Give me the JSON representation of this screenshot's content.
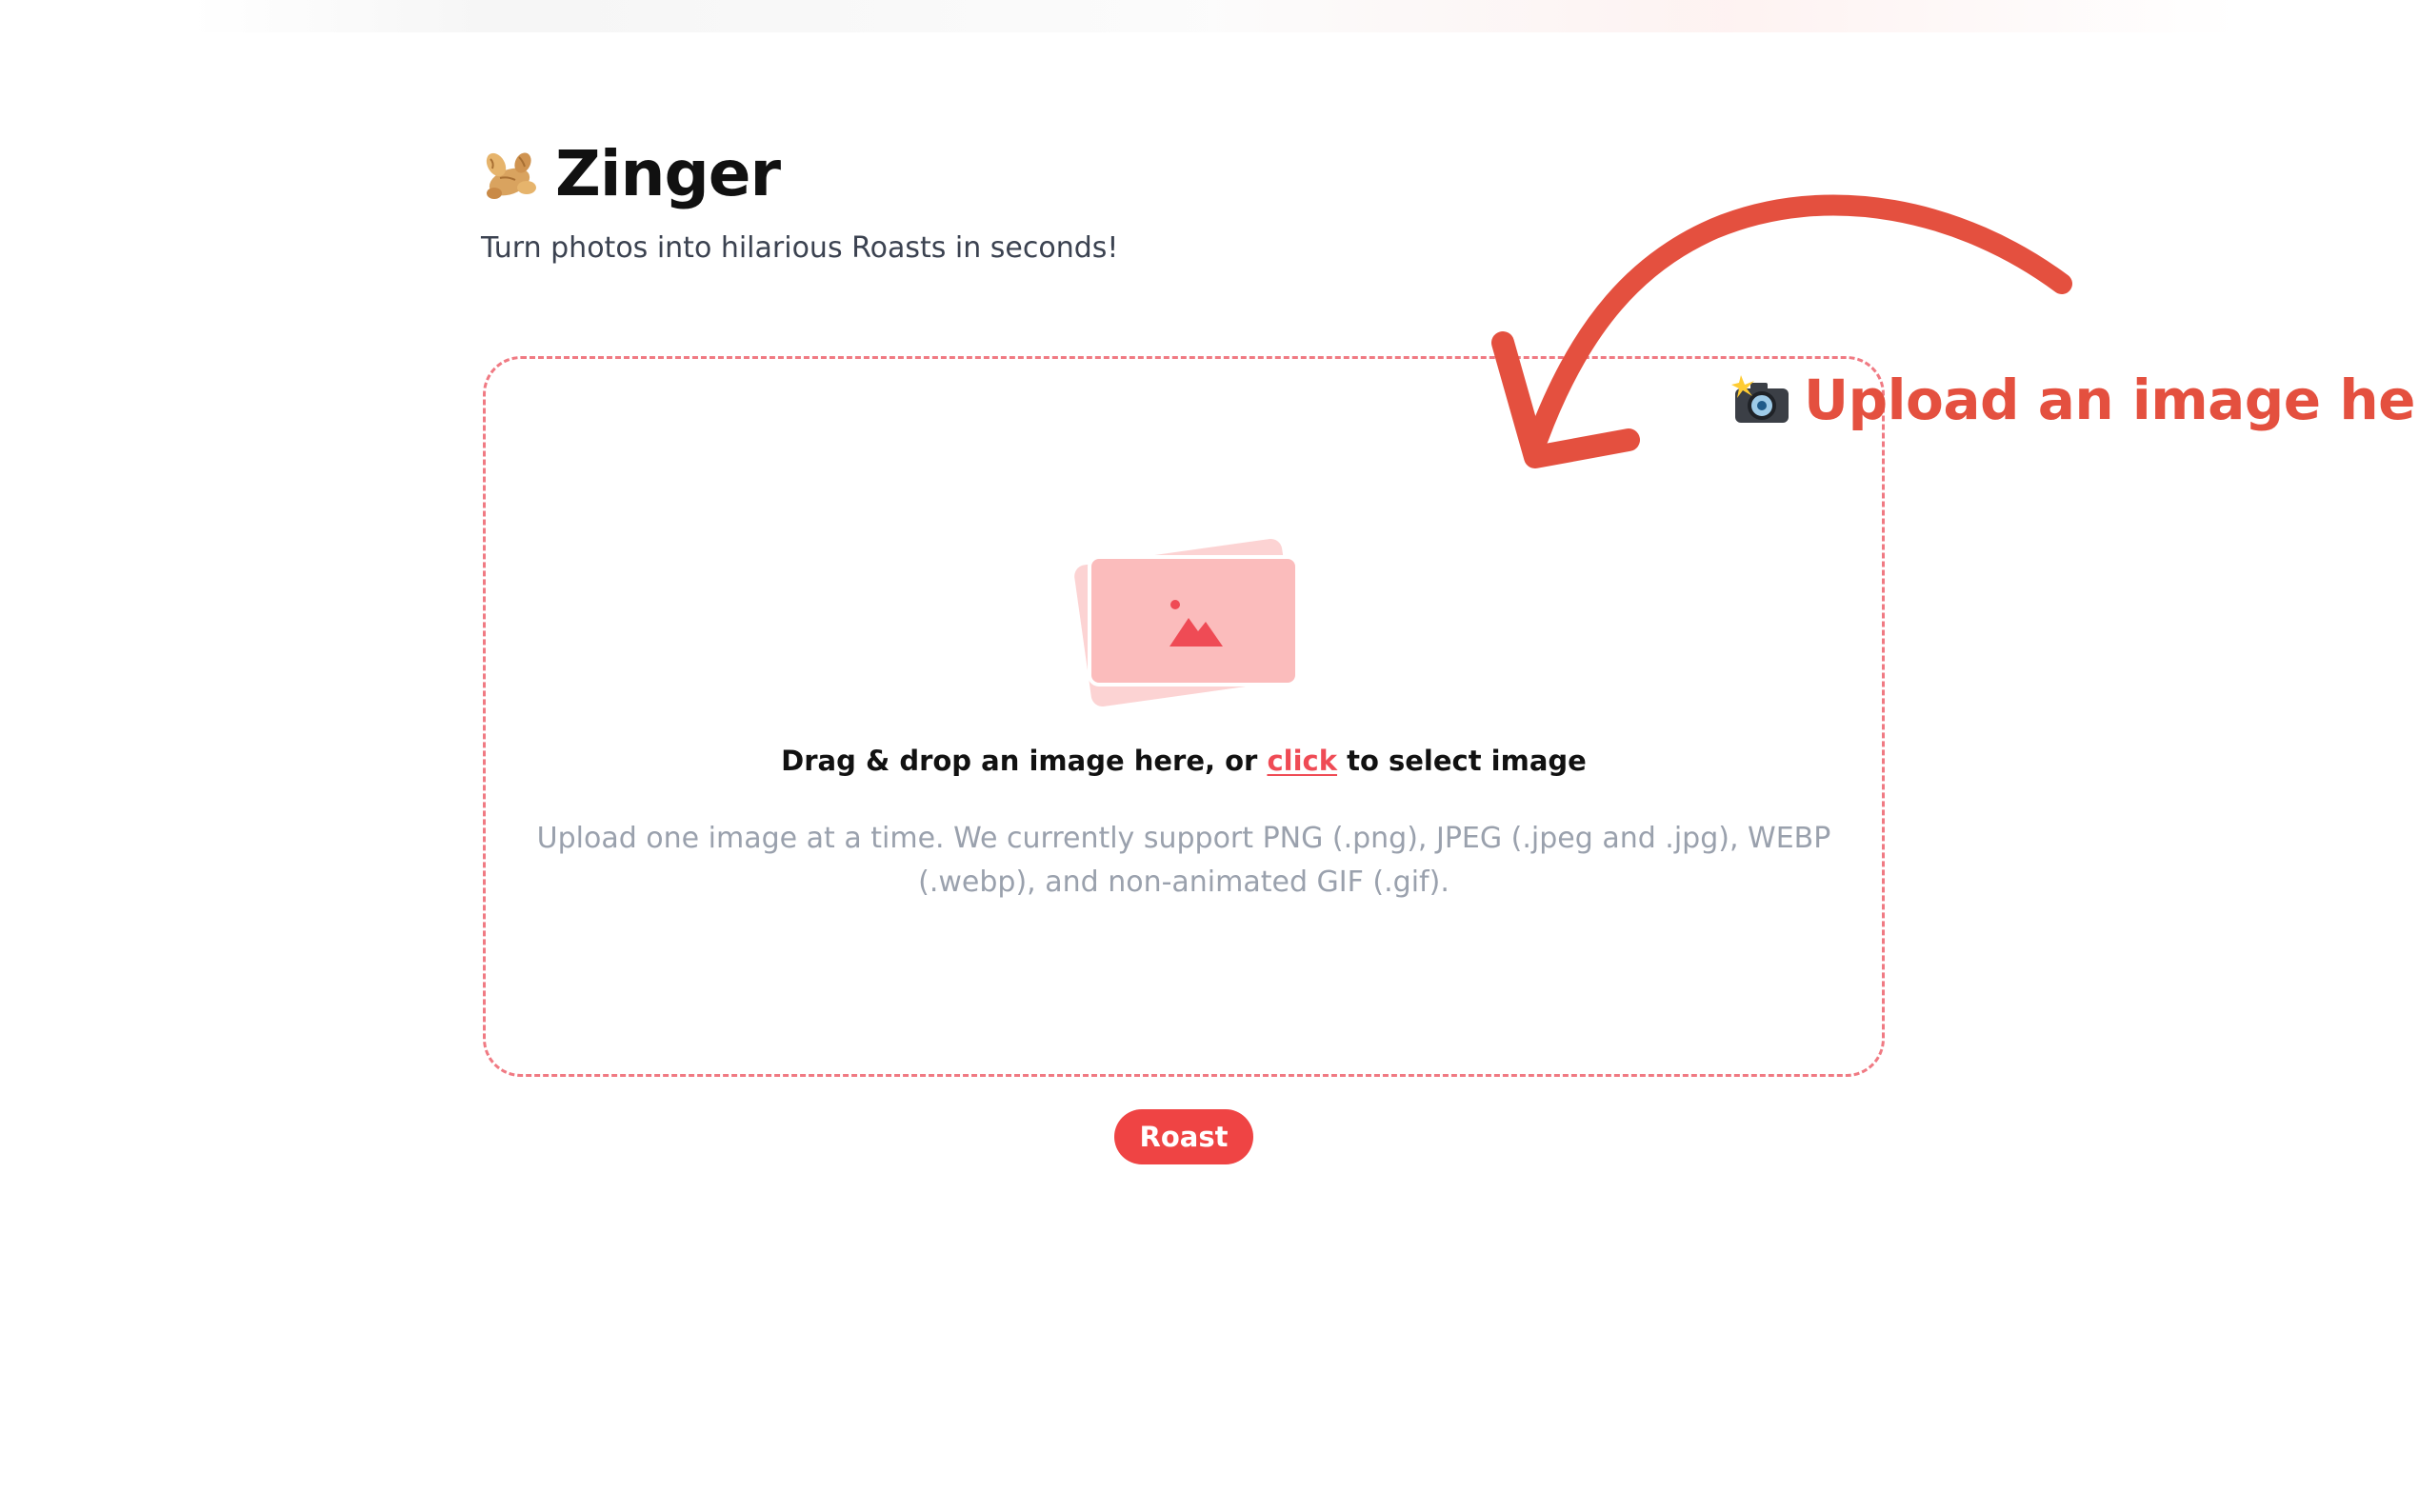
{
  "app": {
    "title": "Zinger",
    "tagline": "Turn photos into hilarious Roasts in seconds!",
    "brand_icon": "ginger-root-icon"
  },
  "dropzone": {
    "title_before": "Drag & drop an image here, or ",
    "title_link": "click",
    "title_after": " to select image",
    "help_text": "Upload one image at a time. We currently support PNG (.png), JPEG (.jpeg and .jpg), WEBP (.webp), and non-animated GIF (.gif).",
    "illustration_icon": "image-placeholder-icon"
  },
  "actions": {
    "roast_label": "Roast"
  },
  "annotation": {
    "text": "Upload an image here",
    "icon": "camera-flash-icon",
    "arrow_icon": "curved-arrow-icon"
  },
  "colors": {
    "accent": "#ef4444",
    "annotation": "#e4503f",
    "dropzone_border": "#f07a83",
    "muted_text": "#9aa1ad"
  }
}
